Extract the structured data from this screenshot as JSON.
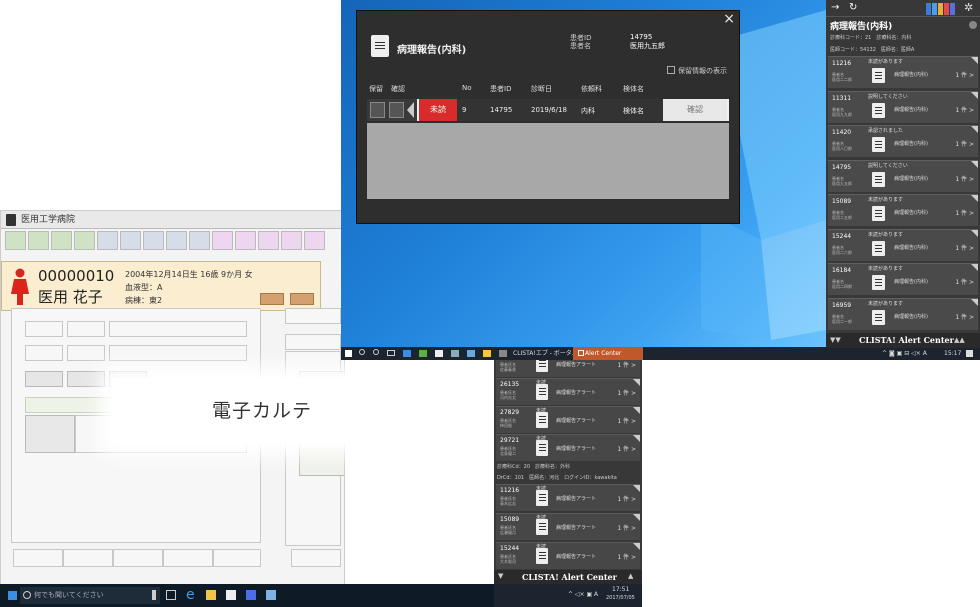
{
  "emr": {
    "title": "医用工学病院",
    "patient_id": "00000010",
    "patient_name": "医用 花子",
    "birth_info": "2004年12月14日生 16歳 9か月 女",
    "blood_type": "血液型：A",
    "ward": "病棟：東2",
    "overlay_label": "電子カルテ"
  },
  "taskbar_bottom": {
    "search_placeholder": "何でも聞いてください"
  },
  "dialog": {
    "title": "病理報告(内科)",
    "patient_id_label": "患者ID",
    "patient_name_label": "患者名",
    "patient_id": "14795",
    "patient_name": "医用九五郎",
    "checkbox_label": "保留情報の表示",
    "headers": [
      "保留",
      "確認",
      "No",
      "患者ID",
      "診断日",
      "依頼科",
      "検体名"
    ],
    "row": {
      "status": "未読",
      "no": "9",
      "patient_id": "14795",
      "date": "2019/6/18",
      "dept": "内科",
      "specimen": "検体名",
      "confirm": "確認"
    },
    "close": "×"
  },
  "desktop_taskbar": {
    "items": [
      "CLISTA!エブ - ボータル",
      "Alert Center"
    ],
    "clock_time": "15:17"
  },
  "right_panel": {
    "nav_forward": "→",
    "nav_reload": "↻",
    "title": "病理報告(内科)",
    "meta1": "診療科コード：21　診療科名：内科",
    "meta2": "医師コード：54132　医師名：医師A",
    "cards": [
      {
        "id": "11216",
        "sub1": "患者名",
        "sub2": "医用二二郎",
        "status": "未読があります",
        "type": "病理報告(内科)",
        "count": "1 件"
      },
      {
        "id": "11311",
        "sub1": "患者名",
        "sub2": "医用九九郎",
        "status": "説明してください",
        "type": "病理報告(内科)",
        "count": "1 件"
      },
      {
        "id": "11420",
        "sub1": "患者名",
        "sub2": "医用八〇郎",
        "status": "承認されました",
        "type": "病理報告(内科)",
        "count": "1 件"
      },
      {
        "id": "14795",
        "sub1": "患者名",
        "sub2": "医用九五郎",
        "status": "説明してください",
        "type": "病理報告(内科)",
        "count": "1 件"
      },
      {
        "id": "15089",
        "sub1": "患者名",
        "sub2": "医用二五郎",
        "status": "未読があります",
        "type": "病理報告(内科)",
        "count": "1 件"
      },
      {
        "id": "15244",
        "sub1": "患者名",
        "sub2": "医用二六郎",
        "status": "未読があります",
        "type": "病理報告(内科)",
        "count": "1 件"
      },
      {
        "id": "16184",
        "sub1": "患者名",
        "sub2": "医用二四郎",
        "status": "未読があります",
        "type": "病理報告(内科)",
        "count": "1 件"
      },
      {
        "id": "16959",
        "sub1": "患者名",
        "sub2": "医用二一郎",
        "status": "未読があります",
        "type": "病理報告(内科)",
        "count": "1 件"
      }
    ],
    "footer": "CLISTA! Alert Center",
    "clock": "15:17"
  },
  "middle_panel": {
    "cards_top": [
      {
        "id": "",
        "sub1": "患者氏名",
        "sub2": "佐藤春香",
        "status": "",
        "type": "病理報告アラート",
        "count": "1 件"
      },
      {
        "id": "26135",
        "sub1": "患者氏名",
        "sub2": "河内光太",
        "status": "未読",
        "type": "病理報告アラート",
        "count": "1 件"
      },
      {
        "id": "27829",
        "sub1": "患者氏名",
        "sub2": "柿田聡",
        "status": "未読",
        "type": "病理報告アラート",
        "count": "1 件"
      },
      {
        "id": "29721",
        "sub1": "患者氏名",
        "sub2": "北条優二",
        "status": "未読",
        "type": "病理報告アラート",
        "count": "1 件"
      }
    ],
    "meta1": "診療科Cd：20　診療科名：外科",
    "meta2": "DrCd：101　医師名：河北　ログインID：kawakita",
    "cards_bottom": [
      {
        "id": "11216",
        "sub1": "患者氏名",
        "sub2": "青木広志",
        "status": "未読",
        "type": "病理報告アラート",
        "count": "1 件"
      },
      {
        "id": "15089",
        "sub1": "患者氏名",
        "sub2": "広瀬優月",
        "status": "未読",
        "type": "病理報告アラート",
        "count": "1 件"
      },
      {
        "id": "15244",
        "sub1": "患者氏名",
        "sub2": "大木聡司",
        "status": "未読",
        "type": "病理報告アラート",
        "count": "1 件"
      }
    ],
    "footer": "CLISTA! Alert Center",
    "clock": "17:51",
    "date": "2017/07/05"
  }
}
